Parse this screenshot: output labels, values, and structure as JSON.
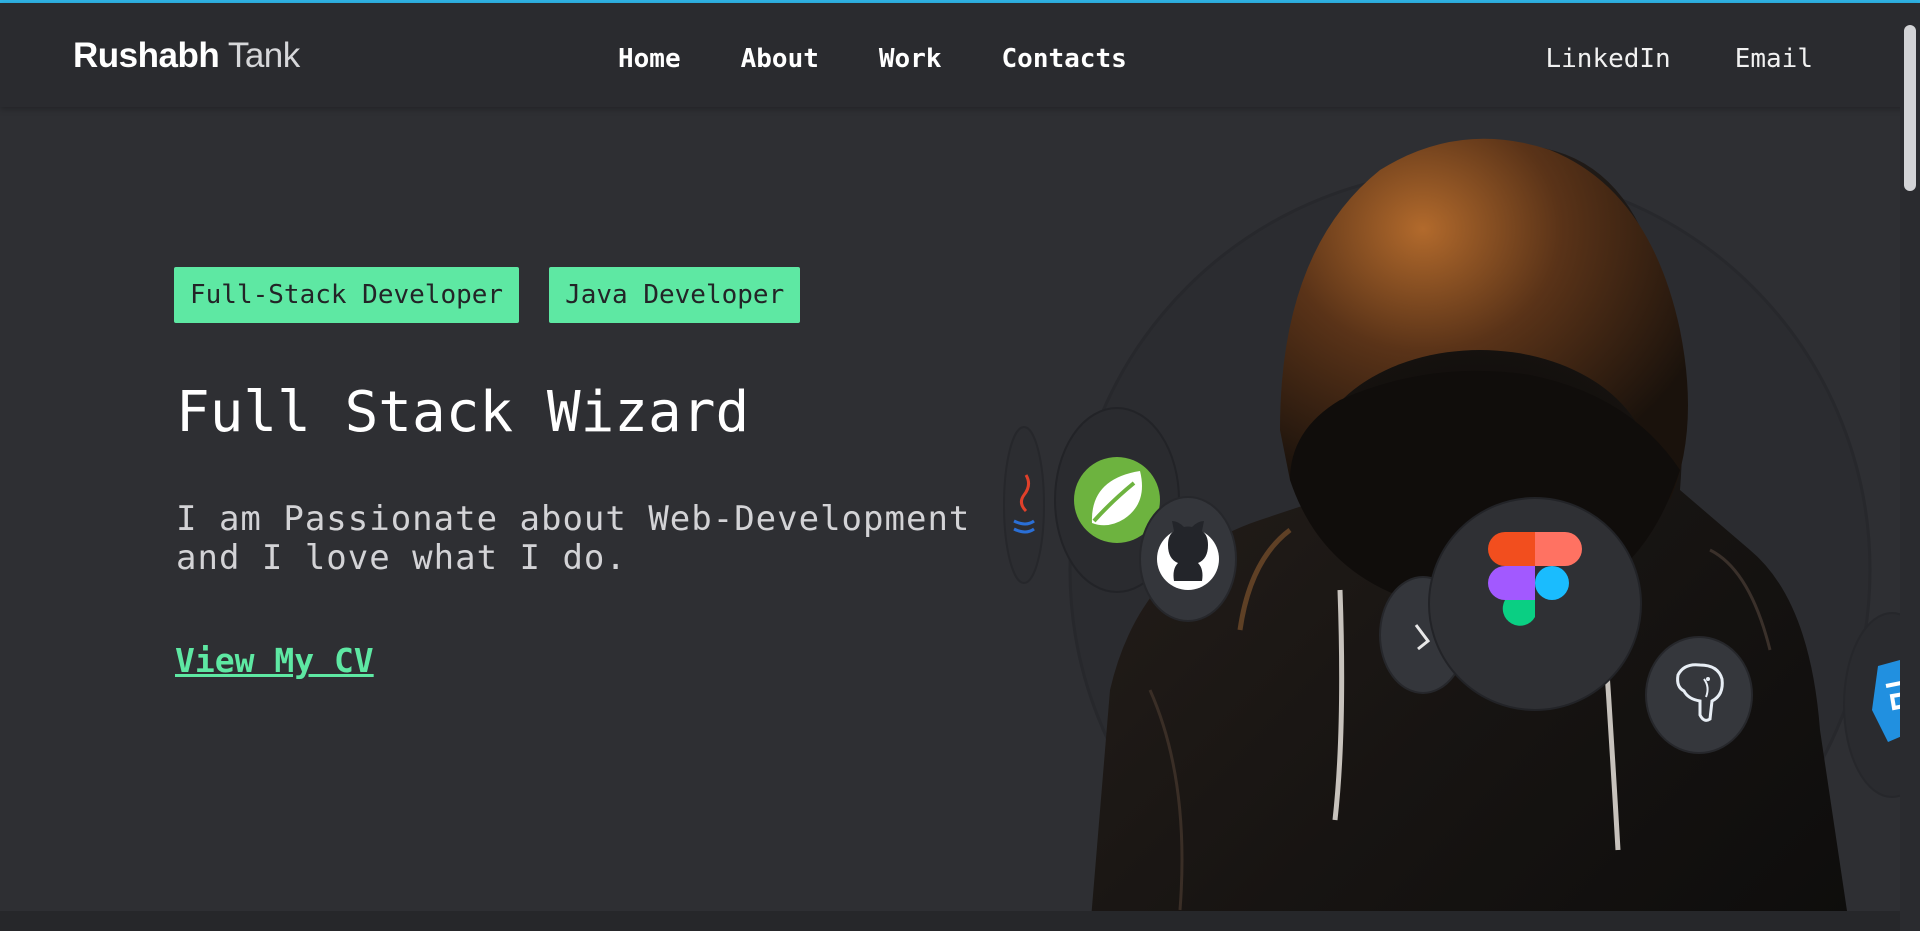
{
  "brand": {
    "first": "Rushabh",
    "last": "Tank"
  },
  "nav": {
    "links": [
      "Home",
      "About",
      "Work",
      "Contacts"
    ]
  },
  "social": {
    "links": [
      "LinkedIn",
      "Email"
    ]
  },
  "hero": {
    "badges": [
      "Full-Stack Developer",
      "Java Developer"
    ],
    "title": "Full Stack Wizard",
    "description": "I am Passionate about Web-Development and I love what I do.",
    "cta": "View My CV"
  },
  "tech_icons": [
    "java-icon",
    "spring-leaf-icon",
    "github-icon",
    "prisma-icon",
    "figma-icon",
    "postgresql-elephant-icon",
    "css3-icon"
  ],
  "colors": {
    "background": "#2e2f33",
    "navbar": "#2a2b2f",
    "accent_green": "#5ee8a3",
    "top_accent": "#2fb4e6"
  }
}
